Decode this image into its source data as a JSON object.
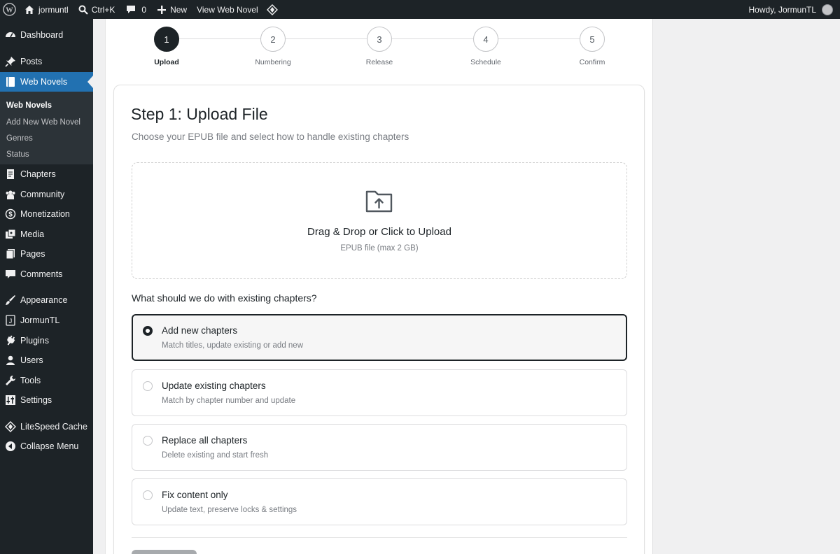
{
  "adminbar": {
    "site_name": "jormuntl",
    "search_shortcut": "Ctrl+K",
    "comments_count": "0",
    "new_label": "New",
    "view_label": "View Web Novel",
    "howdy": "Howdy, JormunTL"
  },
  "sidebar": {
    "items": [
      {
        "label": "Dashboard",
        "icon": "dashboard-icon"
      },
      {
        "label": "Posts",
        "icon": "pin-icon"
      },
      {
        "label": "Web Novels",
        "icon": "book-icon"
      },
      {
        "label": "Chapters",
        "icon": "document-icon"
      },
      {
        "label": "Community",
        "icon": "community-icon"
      },
      {
        "label": "Monetization",
        "icon": "dollar-icon"
      },
      {
        "label": "Media",
        "icon": "media-icon"
      },
      {
        "label": "Pages",
        "icon": "pages-icon"
      },
      {
        "label": "Comments",
        "icon": "comment-icon"
      },
      {
        "label": "Appearance",
        "icon": "brush-icon"
      },
      {
        "label": "JormunTL",
        "icon": "jormuntl-icon"
      },
      {
        "label": "Plugins",
        "icon": "plugin-icon"
      },
      {
        "label": "Users",
        "icon": "user-icon"
      },
      {
        "label": "Tools",
        "icon": "wrench-icon"
      },
      {
        "label": "Settings",
        "icon": "settings-icon"
      },
      {
        "label": "LiteSpeed Cache",
        "icon": "litespeed-icon"
      },
      {
        "label": "Collapse Menu",
        "icon": "collapse-icon"
      }
    ],
    "submenu": [
      "Web Novels",
      "Add New Web Novel",
      "Genres",
      "Status"
    ]
  },
  "stepper": {
    "steps": [
      {
        "number": "1",
        "label": "Upload"
      },
      {
        "number": "2",
        "label": "Numbering"
      },
      {
        "number": "3",
        "label": "Release"
      },
      {
        "number": "4",
        "label": "Schedule"
      },
      {
        "number": "5",
        "label": "Confirm"
      }
    ],
    "active_step": 1
  },
  "card": {
    "title": "Step 1: Upload File",
    "subtitle": "Choose your EPUB file and select how to handle existing chapters"
  },
  "upload": {
    "title": "Drag & Drop or Click to Upload",
    "hint": "EPUB file (max 2 GB)",
    "icon": "folder-upload-icon"
  },
  "chapter_options": {
    "question": "What should we do with existing chapters?",
    "selected_index": 0,
    "options": [
      {
        "title": "Add new chapters",
        "desc": "Match titles, update existing or add new"
      },
      {
        "title": "Update existing chapters",
        "desc": "Match by chapter number and update"
      },
      {
        "title": "Replace all chapters",
        "desc": "Delete existing and start fresh"
      },
      {
        "title": "Fix content only",
        "desc": "Update text, preserve locks & settings"
      }
    ]
  },
  "colors": {
    "admin_dark": "#1d2327",
    "accent": "#2271b1",
    "selected_border": "#1d2327",
    "disabled_button": "#a7aaad"
  }
}
